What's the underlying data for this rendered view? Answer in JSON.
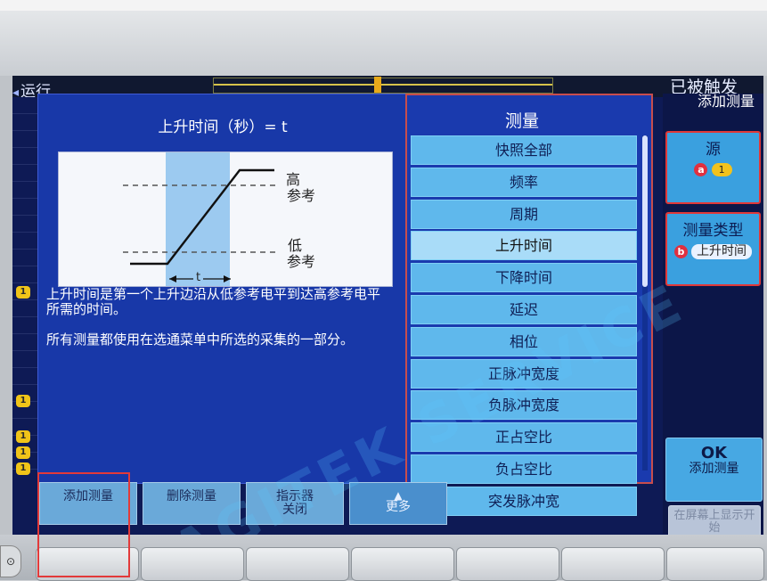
{
  "status": {
    "run_label": "运行",
    "triggered_label": "已被触发"
  },
  "info": {
    "title": "上升时间（秒）= t",
    "diagram": {
      "high_label": "高",
      "low_label": "低",
      "ref_label": "参考",
      "t_label": "t"
    },
    "description": "上升时间是第一个上升边沿从低参考电平到达高参考电平所需的时间。",
    "note": "所有测量都使用在选通菜单中所选的采集的一部分。"
  },
  "menu": {
    "title": "测量",
    "items": [
      {
        "label": "快照全部",
        "selected": false
      },
      {
        "label": "频率",
        "selected": false
      },
      {
        "label": "周期",
        "selected": false
      },
      {
        "label": "上升时间",
        "selected": true
      },
      {
        "label": "下降时间",
        "selected": false
      },
      {
        "label": "延迟",
        "selected": false
      },
      {
        "label": "相位",
        "selected": false
      },
      {
        "label": "正脉冲宽度",
        "selected": false
      },
      {
        "label": "负脉冲宽度",
        "selected": false
      },
      {
        "label": "正占空比",
        "selected": false
      },
      {
        "label": "负占空比",
        "selected": false
      },
      {
        "label": "突发脉冲宽",
        "selected": false
      }
    ]
  },
  "right": {
    "header": "添加测量",
    "source_label": "源",
    "source_badge": "a",
    "source_value": "1",
    "type_label": "测量类型",
    "type_badge": "b",
    "type_value": "上升时间",
    "ok_label": "OK",
    "ok_sub": "添加测量",
    "disabled_label": "在屏幕上显示开始"
  },
  "bottom": {
    "add_label": "添加测量",
    "delete_label": "删除测量",
    "indicator_label": "指示器",
    "indicator_state": "关闭",
    "more_label": "更多"
  },
  "channel_marker": "1",
  "watermark": "AGITEK SERVICE",
  "colors": {
    "screen_bg": "#0e1a55",
    "panel_bg": "#1838a8",
    "menu_item": "#5fb8ec",
    "menu_selected": "#a9dcf8",
    "highlight": "#e23a3a",
    "channel": "#f0c419"
  }
}
